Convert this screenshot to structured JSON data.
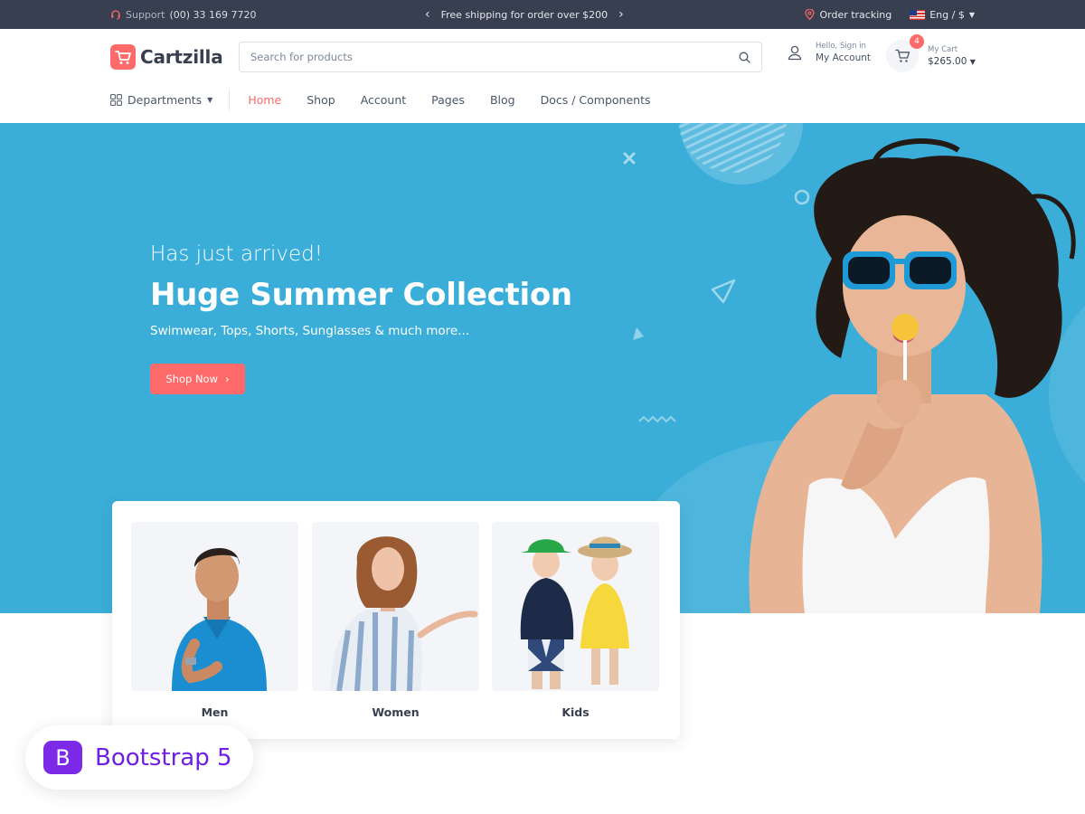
{
  "topbar": {
    "support_label": "Support",
    "support_phone": "(00) 33 169 7720",
    "promo": "Free shipping for order over $200",
    "order_tracking": "Order tracking",
    "language": "Eng / $"
  },
  "header": {
    "brand": "Cartzilla",
    "search_placeholder": "Search for products",
    "account_small": "Hello, Sign in",
    "account_main": "My Account",
    "cart_small": "My Cart",
    "cart_total": "$265.00",
    "cart_count": "4"
  },
  "menu": {
    "departments": "Departments",
    "items": [
      "Home",
      "Shop",
      "Account",
      "Pages",
      "Blog",
      "Docs / Components"
    ]
  },
  "hero": {
    "subtitle": "Has just arrived!",
    "title": "Huge Summer Collection",
    "description": "Swimwear, Tops, Shorts, Sunglasses & much more...",
    "button": "Shop Now"
  },
  "categories": [
    "Men",
    "Women",
    "Kids"
  ],
  "badge": {
    "logo_letter": "B",
    "text": "Bootstrap 5"
  },
  "colors": {
    "accent": "#fe696a",
    "hero_bg": "#3aaed8",
    "topbar_bg": "#373f50",
    "bootstrap_purple": "#7c2ae8"
  }
}
